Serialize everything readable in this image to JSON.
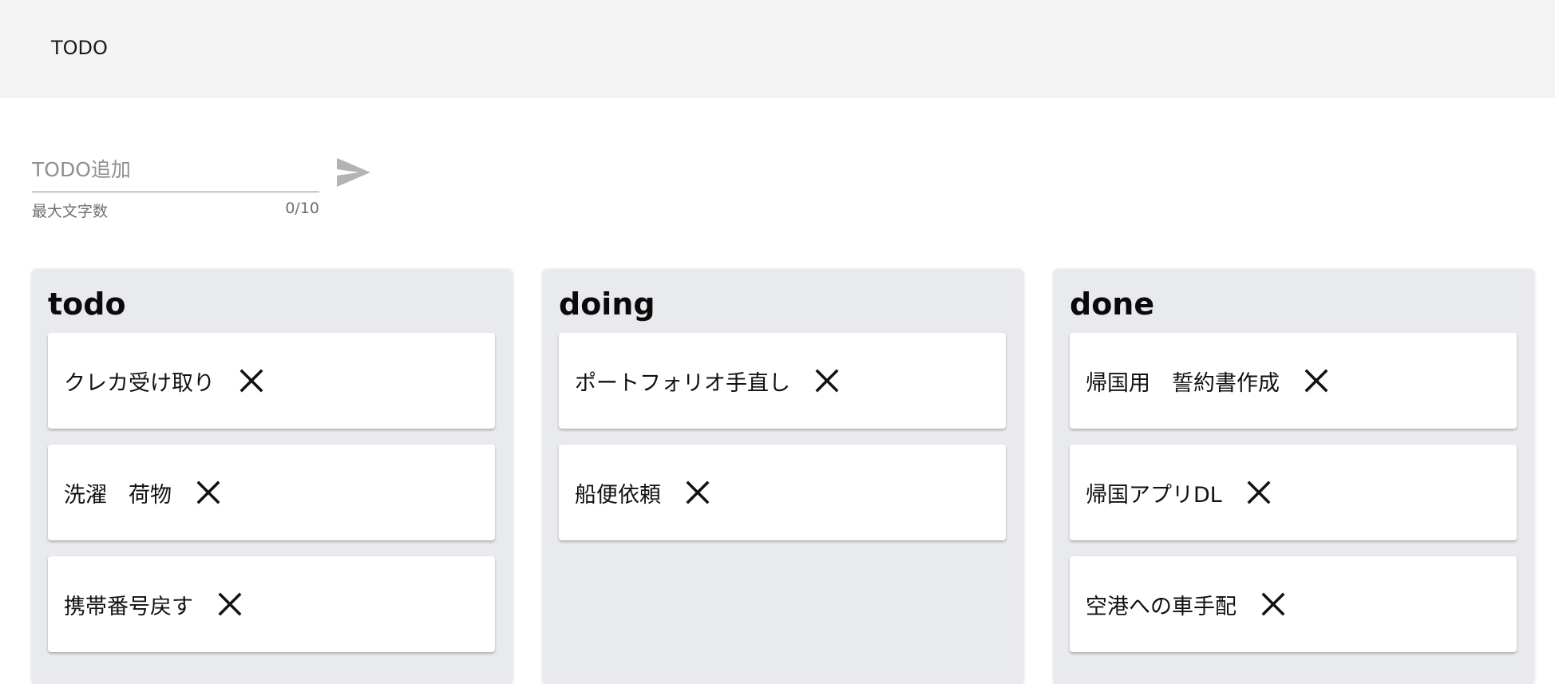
{
  "app_bar": {
    "title": "TODO"
  },
  "add_form": {
    "placeholder": "TODO追加",
    "value": "",
    "hint": "最大文字数",
    "counter": "0/10",
    "send_icon": "send-icon"
  },
  "columns": [
    {
      "title": "todo",
      "cards": [
        {
          "label": "クレカ受け取り"
        },
        {
          "label": "洗濯　荷物"
        },
        {
          "label": "携帯番号戻す"
        }
      ]
    },
    {
      "title": "doing",
      "cards": [
        {
          "label": "ポートフォリオ手直し"
        },
        {
          "label": "船便依頼"
        }
      ]
    },
    {
      "title": "done",
      "cards": [
        {
          "label": "帰国用　誓約書作成"
        },
        {
          "label": "帰国アプリDL"
        },
        {
          "label": "空港への車手配"
        }
      ]
    }
  ],
  "colors": {
    "app_bar_bg": "#f4f4f4",
    "column_bg": "#e9eaed",
    "card_bg": "#ffffff",
    "send_icon": "#b3b3b3"
  }
}
